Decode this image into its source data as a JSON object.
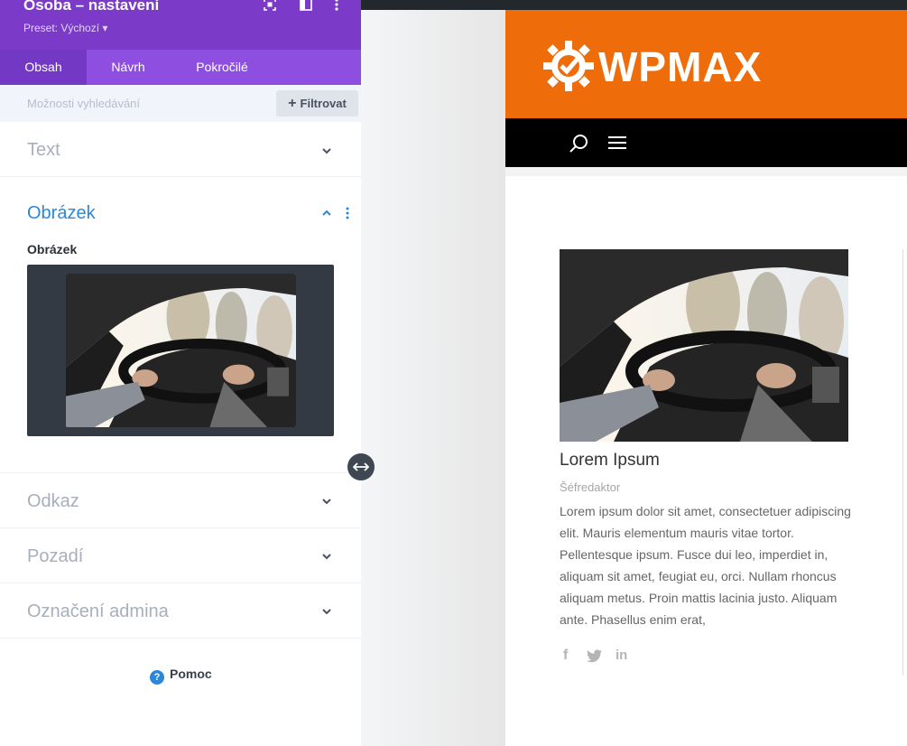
{
  "panel": {
    "title": "Osoba – nastavení",
    "preset": "Preset: Výchozí ▾",
    "header_icons": [
      "fullscreen-icon",
      "split-view-icon",
      "more-vert-icon"
    ],
    "tabs": [
      {
        "label": "Obsah",
        "active": true
      },
      {
        "label": "Návrh",
        "active": false
      },
      {
        "label": "Pokročilé",
        "active": false
      }
    ],
    "search": {
      "placeholder": "Možnosti vyhledávání"
    },
    "filter_label": "Filtrovat",
    "sections": {
      "text": "Text",
      "image": "Obrázek",
      "link": "Odkaz",
      "background": "Pozadí",
      "admin_label": "Označení admina"
    },
    "image_field_label": "Obrázek",
    "help_label": "Pomoc",
    "colors": {
      "header": "#7b3bc8",
      "tabs": "#8e4ee0",
      "accent": "#2b87da"
    }
  },
  "site": {
    "logo_text": "WPMAX",
    "colors": {
      "header": "#ef6c0b",
      "nav": "#000000"
    },
    "person": {
      "name": "Lorem Ipsum",
      "position": "Šéfredaktor",
      "bio": "Lorem ipsum dolor sit amet, consectetuer adipiscing elit. Mauris elementum mauris vitae tortor. Pellentesque ipsum. Fusce dui leo, imperdiet in, aliquam sit amet, feugiat eu, orci. Nullam rhoncus aliquam metus. Proin mattis lacinia justo. Aliquam ante. Phasellus enim erat,"
    },
    "social": [
      "facebook-icon",
      "twitter-icon",
      "linkedin-icon"
    ]
  }
}
